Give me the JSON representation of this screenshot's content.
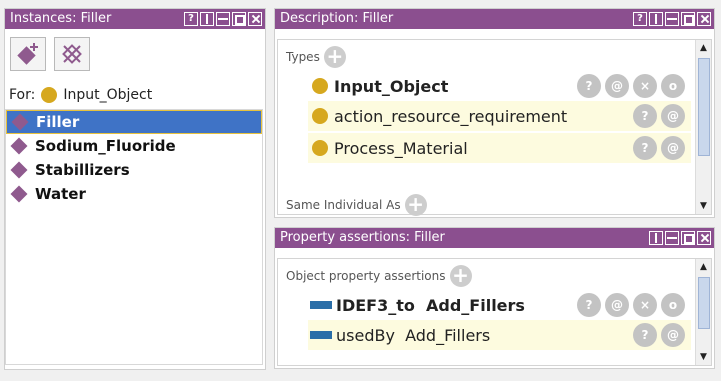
{
  "instances_panel": {
    "title": "Instances: Filler",
    "toolbar": {
      "add_icon": "add-individual-icon",
      "delete_icon": "delete-individual-icon"
    },
    "for_label": "For:",
    "for_value": "Input_Object",
    "items": [
      {
        "label": "Filler",
        "selected": true
      },
      {
        "label": "Sodium_Fluoride",
        "selected": false
      },
      {
        "label": "Stabillizers",
        "selected": false
      },
      {
        "label": "Water",
        "selected": false
      }
    ]
  },
  "description_panel": {
    "title": "Description: Filler",
    "types_label": "Types",
    "types": [
      {
        "label": "Input_Object",
        "bold": true,
        "actions": [
          "?",
          "@",
          "×",
          "o"
        ]
      },
      {
        "label": "action_resource_requirement",
        "bold": false,
        "actions": [
          "?",
          "@"
        ]
      },
      {
        "label": "Process_Material",
        "bold": false,
        "actions": [
          "?",
          "@"
        ]
      }
    ],
    "same_individual_label": "Same Individual As"
  },
  "property_panel": {
    "title": "Property assertions: Filler",
    "object_property_label": "Object property assertions",
    "assertions": [
      {
        "label": "IDEF3_to  Add_Fillers",
        "bold": true,
        "actions": [
          "?",
          "@",
          "×",
          "o"
        ]
      },
      {
        "label": "usedBy  Add_Fillers",
        "bold": false,
        "actions": [
          "?",
          "@"
        ]
      }
    ]
  },
  "window_controls": {
    "help": "?"
  },
  "colors": {
    "titlebar": "#8b4f8f",
    "selection": "#3f73c6",
    "individual": "#8f5a8e",
    "class": "#d6a81f",
    "property": "#2a6ea8"
  }
}
